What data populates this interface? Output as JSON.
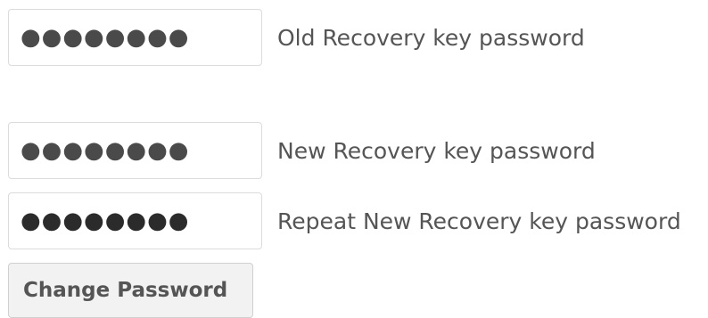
{
  "form": {
    "old_password": {
      "value": "●●●●●●●●",
      "label": "Old Recovery key password"
    },
    "new_password": {
      "value": "●●●●●●●●",
      "label": "New Recovery key password"
    },
    "repeat_password": {
      "value": "●●●●●●●●",
      "label": "Repeat New Recovery key password"
    },
    "submit_label": "Change Password"
  }
}
